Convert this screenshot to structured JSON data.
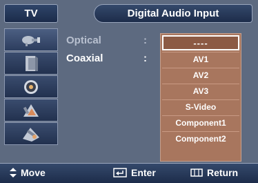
{
  "header": {
    "tab": "TV",
    "title": "Digital Audio Input"
  },
  "sidebar": {
    "items": [
      {
        "icon": "satellite-dish-icon",
        "active": true
      },
      {
        "icon": "speaker-box-icon",
        "active": false
      },
      {
        "icon": "speaker-cone-icon",
        "active": false
      },
      {
        "icon": "channel-tools-icon",
        "active": false
      },
      {
        "icon": "setup-tools-icon",
        "active": false
      }
    ]
  },
  "settings": {
    "optical_label": "Optical",
    "coaxial_label": "Coaxial",
    "separator": ":"
  },
  "dropdown": {
    "options": [
      "----",
      "AV1",
      "AV2",
      "AV3",
      "S-Video",
      "Component1",
      "Component2"
    ],
    "selected": "----"
  },
  "footer": {
    "move": "Move",
    "enter": "Enter",
    "return": "Return"
  },
  "colors": {
    "background": "#5d6a80",
    "dropdown": "#a8765e",
    "header": "#1d2c4a"
  }
}
